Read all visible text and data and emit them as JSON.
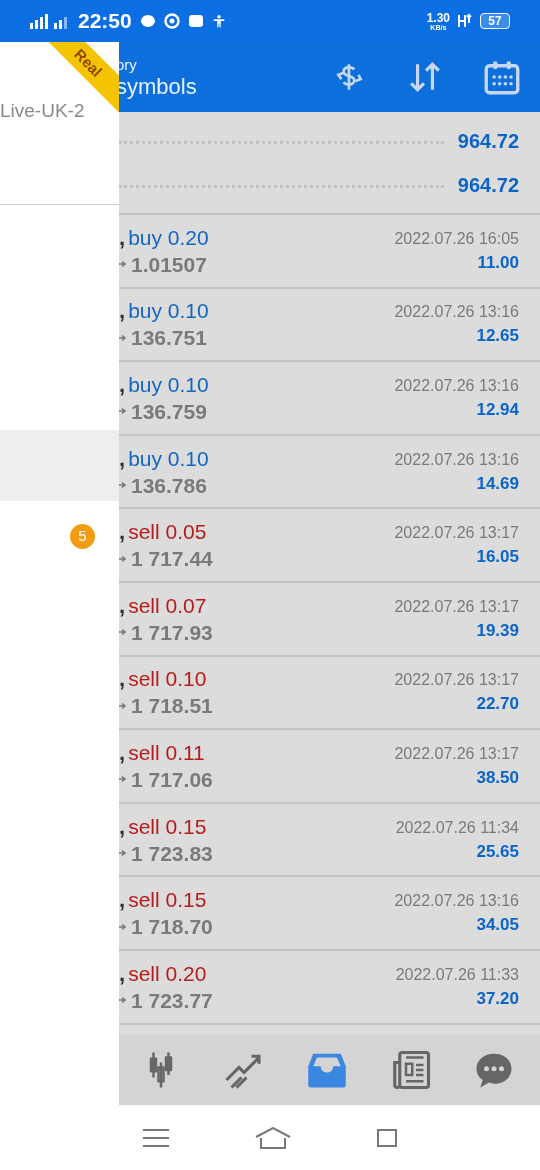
{
  "status_bar": {
    "time": "22:50",
    "speed": "1.30",
    "speed_unit": "KB/s",
    "battery": "57"
  },
  "header": {
    "title_top": "ory",
    "title": "symbols"
  },
  "drawer": {
    "account": "Live-UK-2",
    "ribbon": "Real",
    "badge": "5"
  },
  "summary": [
    "964.72",
    "964.72"
  ],
  "trades": [
    {
      "symbol_tail": ",",
      "color": "#1366c4",
      "label": "buy 0.20",
      "price": "1.01507",
      "time": "2022.07.26 16:05",
      "profit": "11.00"
    },
    {
      "symbol_tail": ",",
      "color": "#1366c4",
      "label": "buy 0.10",
      "price": "136.751",
      "time": "2022.07.26 13:16",
      "profit": "12.65"
    },
    {
      "symbol_tail": ",",
      "color": "#1366c4",
      "label": "buy 0.10",
      "price": "136.759",
      "time": "2022.07.26 13:16",
      "profit": "12.94"
    },
    {
      "symbol_tail": ",",
      "color": "#1366c4",
      "label": "buy 0.10",
      "price": "136.786",
      "time": "2022.07.26 13:16",
      "profit": "14.69"
    },
    {
      "symbol_tail": ",",
      "color": "#b71c1c",
      "label": "sell 0.05",
      "price": "1 717.44",
      "time": "2022.07.26 13:17",
      "profit": "16.05"
    },
    {
      "symbol_tail": ",",
      "color": "#b71c1c",
      "label": "sell 0.07",
      "price": "1 717.93",
      "time": "2022.07.26 13:17",
      "profit": "19.39"
    },
    {
      "symbol_tail": ",",
      "color": "#b71c1c",
      "label": "sell 0.10",
      "price": "1 718.51",
      "time": "2022.07.26 13:17",
      "profit": "22.70"
    },
    {
      "symbol_tail": ",",
      "color": "#b71c1c",
      "label": "sell 0.11",
      "price": "1 717.06",
      "time": "2022.07.26 13:17",
      "profit": "38.50"
    },
    {
      "symbol_tail": ",",
      "color": "#b71c1c",
      "label": "sell 0.15",
      "price": "1 723.83",
      "time": "2022.07.26 11:34",
      "profit": "25.65"
    },
    {
      "symbol_tail": ",",
      "color": "#b71c1c",
      "label": "sell 0.15",
      "price": "1 718.70",
      "time": "2022.07.26 13:16",
      "profit": "34.05"
    },
    {
      "symbol_tail": ",",
      "color": "#b71c1c",
      "label": "sell 0.20",
      "price": "1 723.77",
      "time": "2022.07.26 11:33",
      "profit": "37.20"
    }
  ],
  "bottom_tabs": [
    {
      "kind": "quotes",
      "selected": false
    },
    {
      "kind": "chart",
      "selected": false
    },
    {
      "kind": "trade",
      "selected": true
    },
    {
      "kind": "news",
      "selected": false
    },
    {
      "kind": "chat",
      "selected": false
    }
  ]
}
